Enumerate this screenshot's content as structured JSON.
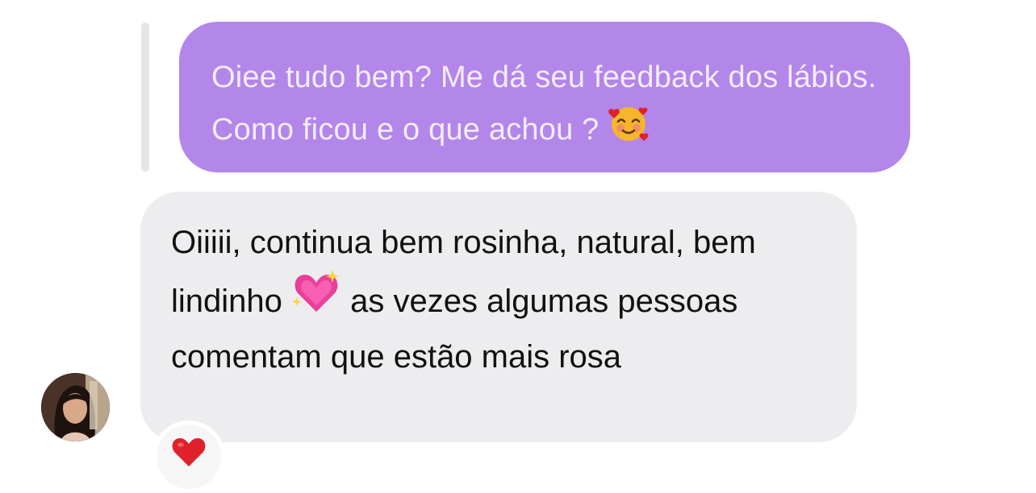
{
  "thread": {
    "quoted_message": {
      "text": "Oiee tudo bem? Me dá seu feedback dos lábios. Como ficou e o que achou ?",
      "emoji": "smiling-face-with-hearts"
    },
    "reply_message": {
      "line_part1": "Oiiiii, continua bem rosinha, natural, bem lindinho",
      "emoji": "sparkling-heart",
      "line_part2": "as vezes algumas pessoas comentam que estão mais rosa"
    },
    "reaction": {
      "emoji": "red-heart"
    }
  },
  "colors": {
    "quoted_bubble": "#b386ea",
    "reply_bubble": "#ededef",
    "reaction_heart": "#e0202a"
  }
}
